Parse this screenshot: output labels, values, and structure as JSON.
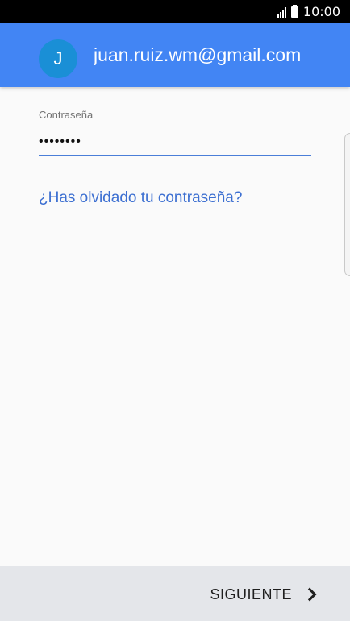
{
  "status_bar": {
    "time": "10:00",
    "icons": [
      "signal-icon",
      "battery-icon"
    ]
  },
  "header": {
    "avatar_initial": "J",
    "account_email": "juan.ruiz.wm@gmail.com",
    "background_color": "#4285f4"
  },
  "form": {
    "password_label": "Contraseña",
    "password_value": "••••••••",
    "underline_color": "#4a7ed8",
    "forgot_password_link": "¿Has olvidado tu contraseña?"
  },
  "footer": {
    "next_button_label": "SIGUIENTE",
    "next_icon": "chevron-right-icon"
  }
}
